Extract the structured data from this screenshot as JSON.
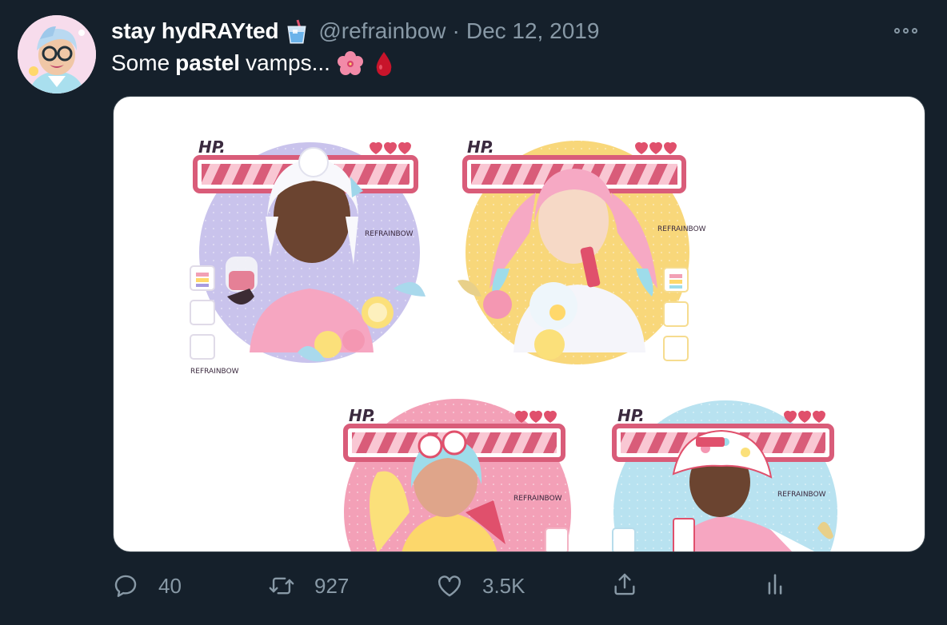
{
  "tweet": {
    "display_name": "stay hydRAYted",
    "handle": "@refrainbow",
    "separator": "·",
    "date": "Dec 12, 2019",
    "text_before": "Some",
    "text_bold": "pastel",
    "text_after": "vamps...",
    "emojis": [
      "hibiscus-emoji",
      "blood-drop-emoji"
    ]
  },
  "media": {
    "cards": [
      {
        "hp_label": "HP.",
        "watermark": "REFRAINBOW",
        "watermark2": "REFRAINBOW",
        "circle_color": "#c9c3ec"
      },
      {
        "hp_label": "HP.",
        "watermark": "REFRAINBOW",
        "circle_color": "#f8d77a"
      },
      {
        "hp_label": "HP.",
        "watermark": "REFRAINBOW",
        "circle_color": "#f3a0b7"
      },
      {
        "hp_label": "HP.",
        "watermark": "REFRAINBOW",
        "circle_color": "#b8e2f0"
      }
    ],
    "hp_bar_color": "#d95c79",
    "heart_color": "#e0506c"
  },
  "actions": {
    "replies": "40",
    "retweets": "927",
    "likes": "3.5K"
  }
}
